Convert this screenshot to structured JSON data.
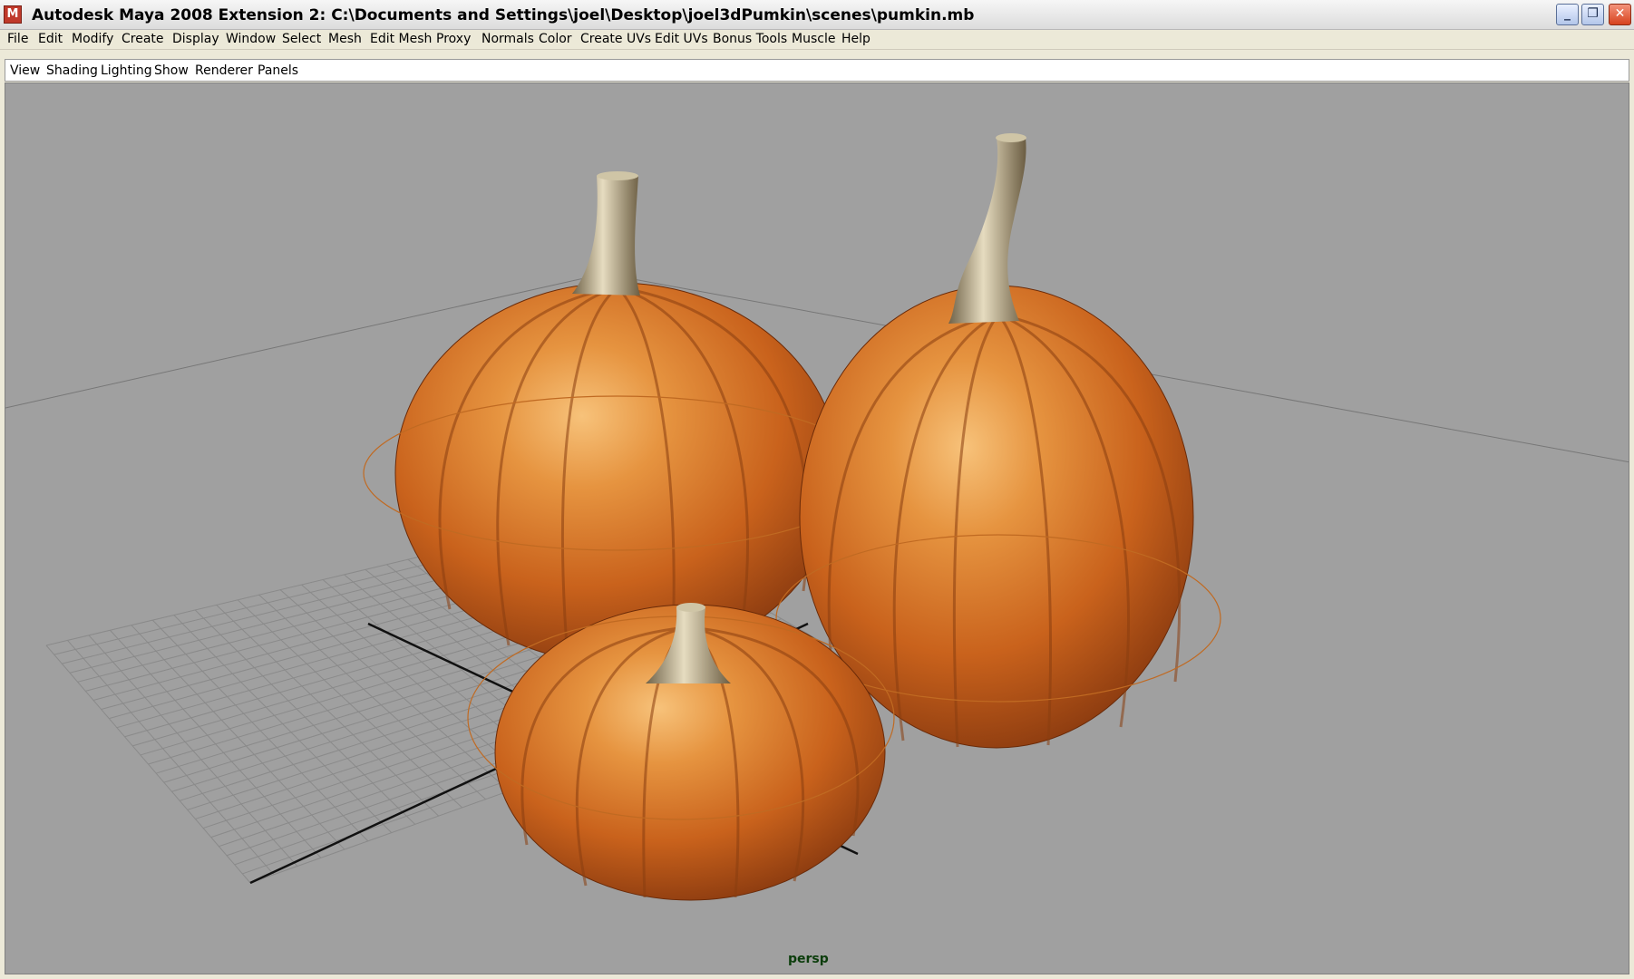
{
  "window": {
    "title": "Autodesk Maya 2008 Extension 2: C:\\Documents and Settings\\joel\\Desktop\\joel3dPumkin\\scenes\\pumkin.mb",
    "app_icon_glyph": "M",
    "minimize_glyph": "_",
    "restore_glyph": "❐",
    "close_glyph": "✕"
  },
  "menubar": {
    "items": [
      "File",
      "Edit",
      "Modify",
      "Create",
      "Display",
      "Window",
      "Select",
      "Mesh",
      "Edit Mesh",
      "Proxy",
      "Normals",
      "Color",
      "Create UVs",
      "Edit UVs",
      "Bonus Tools",
      "Muscle",
      "Help"
    ]
  },
  "panel_menu": {
    "items": [
      "View",
      "Shading",
      "Lighting",
      "Show",
      "Renderer",
      "Panels"
    ]
  },
  "viewport": {
    "camera_label": "persp",
    "background_color": "#a0a0a0",
    "pumpkin_color": "#d8731f",
    "stem_color": "#b5a47e",
    "selection_ring_color": "#c06a22",
    "grid_color": "#8a8a8a"
  },
  "icons": {
    "app": "maya-app-icon",
    "minimize": "minimize-icon",
    "restore": "restore-icon",
    "close": "close-icon"
  }
}
